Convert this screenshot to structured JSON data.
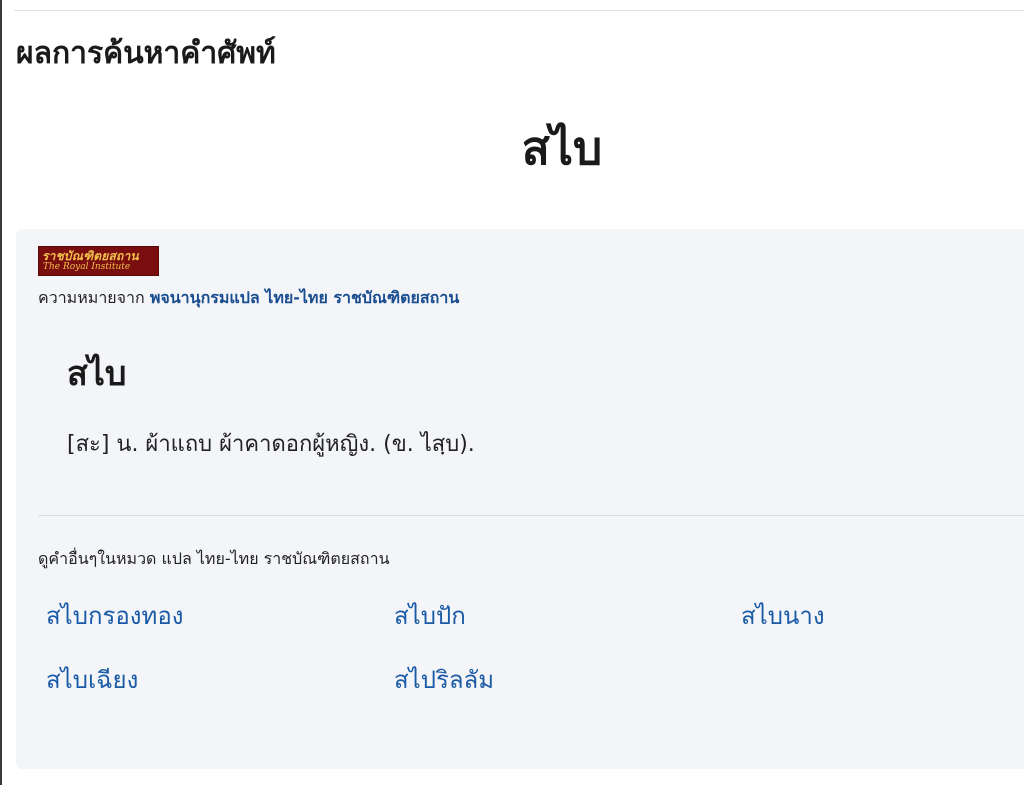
{
  "page": {
    "section_title": "ผลการค้นหาคำศัพท์",
    "headword": "สไบ"
  },
  "card": {
    "logo": {
      "line1": "ราชบัณฑิตยสถาน",
      "line2": "The Royal Institute",
      "bg_color": "#7a0d0d",
      "text_color": "#f2c14e"
    },
    "source_prefix": "ความหมายจาก",
    "source_link": "พจนานุกรมแปล ไทย-ไทย ราชบัณฑิตยสถาน",
    "entry_word": "สไบ",
    "definition": "[สะ] น. ผ้าแถบ ผ้าคาดอกผู้หญิง. (ข. ไสฺบ).",
    "related_heading": "ดูคำอื่นๆในหมวด แปล ไทย-ไทย ราชบัณฑิตยสถาน",
    "related_words": [
      "สไบกรองทอง",
      "สไบปัก",
      "สไบนาง",
      "สไบเฉียง",
      "สไปริลลัม"
    ]
  },
  "colors": {
    "link": "#1a5aa6",
    "card_bg": "#f3f5f8"
  }
}
